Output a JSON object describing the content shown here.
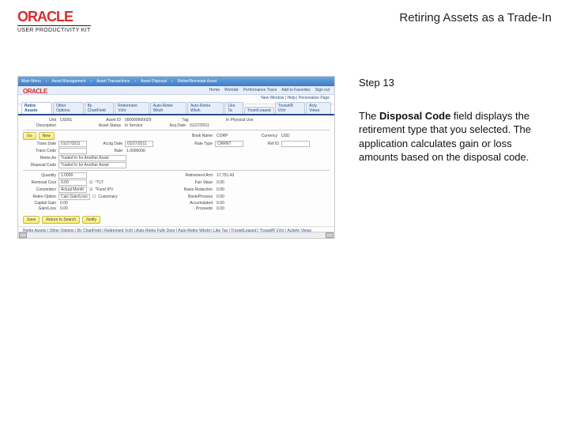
{
  "header": {
    "logo_text": "ORACLE",
    "logo_sub": "USER PRODUCTIVITY KIT",
    "page_title": "Retiring Assets as a Trade-In"
  },
  "side": {
    "step": "Step 13",
    "para_lead": "The ",
    "para_bold": "Disposal Code",
    "para_rest": " field displays the retirement type that you selected. The application calculates gain or loss amounts based on the disposal code."
  },
  "ss": {
    "crumbs": [
      "Main Menu",
      "Asset Management",
      "Asset Transactions",
      "Asset Disposal",
      "Retire/Reinstate Asset"
    ],
    "bar2": [
      "Home",
      "Worklist",
      "Performance Trace",
      "Add to Favorites",
      "Sign out"
    ],
    "oracle": "ORACLE",
    "personal": "New Window | Help | Personalize Page",
    "tabs": [
      "Retire Assets",
      "Other Options",
      "By ChartField",
      "Retirement Vchr",
      "Auto-Retire Wksh",
      "Auto-Retire Wksh",
      "Like Ta",
      "Trxwt/Leased",
      "Trxswt/R Vchr",
      "Acty Views"
    ],
    "unit_lbl": "Unit",
    "unit": "US001",
    "assetid_lbl": "Asset ID",
    "assetid": "000000000029",
    "tag_lbl": "Tag",
    "tag": "",
    "desc_lbl": "Description",
    "desc": "",
    "assetstatus_lbl": "Asset Status",
    "assetstatus": "In Service",
    "ipd_lbl": "In Physical Use",
    "go_lbl": "Go",
    "new_lbl": "New",
    "acqdate_lbl": "Acq Date",
    "acqdate": "01/27/2011",
    "book_lbl": "Book Name",
    "book": "CORP",
    "currency_lbl": "Currency",
    "currency": "USD",
    "transdate_lbl": "Trans Date",
    "transdate": "01/27/2011",
    "acctdate_lbl": "Acctg Date",
    "acctdate": "01/27/2011",
    "transcode_lbl": "Trans Code",
    "transcode": "",
    "ratetype_lbl": "Rate Type",
    "ratetype": "CRRNT",
    "rate_lbl": "Rate",
    "rate": "1.0000000",
    "refid_lbl": "Ref ID",
    "refid": "",
    "disposal_lbl": "Disposal Code",
    "disposal": "Traded In for Another Asset",
    "retireas_lbl": "Retire As",
    "retireas": "Traded In for Another Asset",
    "quantity_lbl": "Quantity",
    "quantity": "1.0000",
    "removal_lbl": "Removal Cost",
    "removal": "0.00",
    "tlt_lbl": "*TLT",
    "tlt": "Yes",
    "retireamt_lbl": "Retirement Amt",
    "retireamt": "17,751.43",
    "fairval_lbl": "Fair Value",
    "fairval": "0.00",
    "capgain_lbl": "Capital Gain",
    "capgain": "0.00",
    "convention_lbl": "Convention",
    "convention": "Actual Month",
    "fund_lbl": "*Fund IPV",
    "basisred_lbl": "Basis Reduction",
    "basisred": "0.00",
    "blproc_lbl": "Book/Process",
    "blproc": "0.00",
    "retireopt_lbl": "Retire Option",
    "retireopt": "Calc Gain/Loss",
    "customary_lbl": "Customary",
    "gainloss_lbl": "Gain/Loss",
    "gainloss": "0.00",
    "accum_lbl": "Accumulated",
    "accum": "0.00",
    "proceeds_lbl": "Proceeds",
    "proceeds": "0.00",
    "btn_save": "Save",
    "btn_return": "Return to Search",
    "btn_notify": "Notify",
    "footer": "Retire Assets | Other Options | By ChartField | Retirement Vchr | Auto-Retire Fully Depr | Auto-Retire Wksht | Like Tax | Trxswt/Leased | Trxswt/R Vchr | Activity Views"
  }
}
